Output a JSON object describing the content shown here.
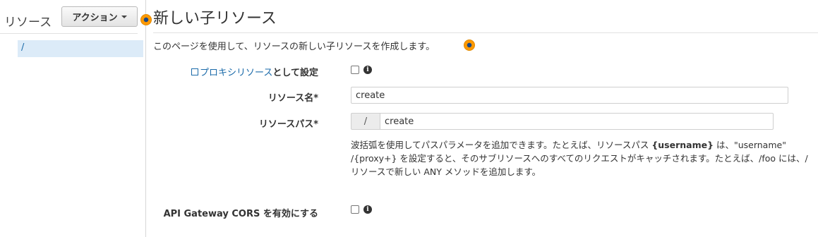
{
  "sidebar": {
    "title": "リソース",
    "actions_label": "アクション",
    "tree_item": "/"
  },
  "main": {
    "title": "新しい子リソース",
    "description": "このページを使用して、リソースの新しい子リソースを作成します。"
  },
  "form": {
    "proxy_link": "プロキシリソース",
    "proxy_suffix": "として設定",
    "resource_name_label": "リソース名*",
    "resource_name_value": "create",
    "resource_path_label": "リソースパス*",
    "resource_path_prefix": "/",
    "resource_path_value": "create",
    "help_1": "波括弧を使用してパスパラメータを追加できます。たとえば、リソースパス ",
    "help_bold": "{username}",
    "help_2": " は、\"username\" /{proxy+} を設定すると、そのサブリソースへのすべてのリクエストがキャッチされます。たとえば、/foo には、/ リソースで新しい ANY メソッドを追加します。",
    "cors_label": "API Gateway CORS を有効にする"
  },
  "colors": {
    "accent": "#ff9900",
    "link": "#1a6aa9",
    "selected_bg": "#dcebf8"
  },
  "icons": {
    "info": "info-circle-icon",
    "external_link": "external-link-icon",
    "help_dot": "orange-help-dot-icon",
    "dropdown": "chevron-down-icon"
  }
}
